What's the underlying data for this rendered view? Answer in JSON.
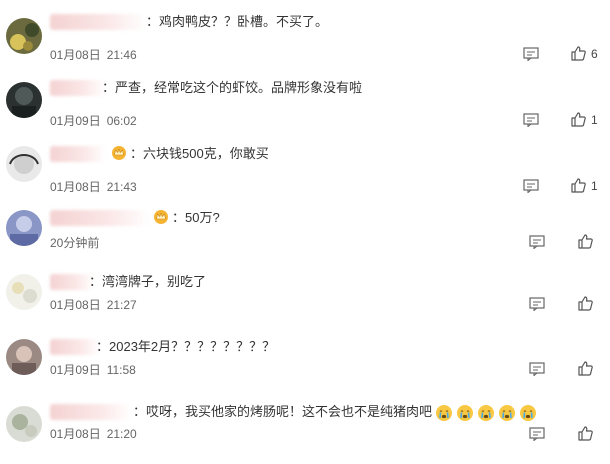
{
  "comments": [
    {
      "text": "鸡肉鸭皮？？卧槽。不买了。",
      "date": "01月08日",
      "time": "21:46",
      "likes": "6"
    },
    {
      "text": "严查，经常吃这个的虾饺。品牌形象没有啦",
      "date": "01月09日",
      "time": "06:02",
      "likes": "1"
    },
    {
      "text": "六块钱500克，你敢买",
      "date": "01月08日",
      "time": "21:43",
      "likes": "1"
    },
    {
      "text": "50万?",
      "date": "20分钟前",
      "time": "",
      "likes": ""
    },
    {
      "text": "湾湾牌子，别吃了",
      "date": "01月08日",
      "time": "21:27",
      "likes": ""
    },
    {
      "text": "2023年2月？？？？？？？？",
      "date": "01月09日",
      "time": "11:58",
      "likes": ""
    },
    {
      "text": "哎呀，我买他家的烤肠呢！这不会也不是纯猪肉吧",
      "date": "01月08日",
      "time": "21:20",
      "likes": ""
    }
  ],
  "colon": "：",
  "icons": {
    "reply": "comment-icon",
    "like": "thumbs-up-icon",
    "badge": "crown-badge-icon",
    "emoji": "crying-emoji-icon"
  }
}
